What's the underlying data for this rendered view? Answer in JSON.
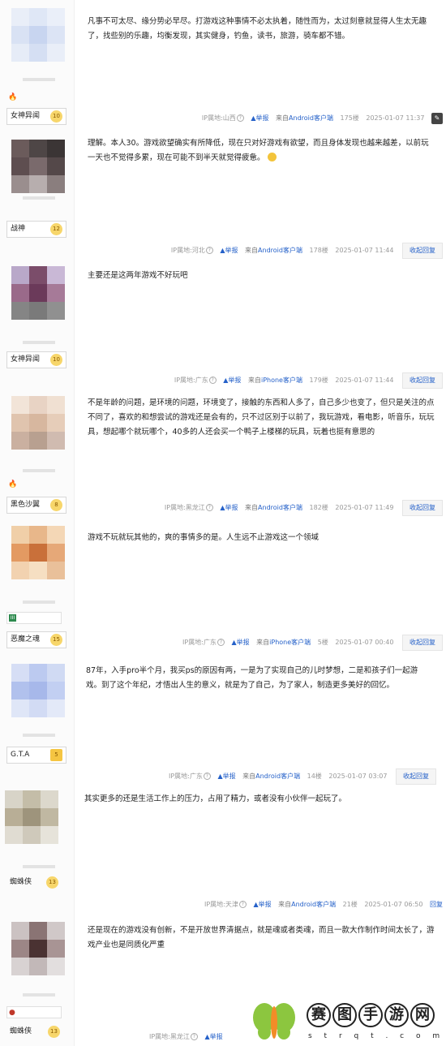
{
  "posts": [
    {
      "user": "女神异闻",
      "level": "10",
      "text": "凡事不可太尽、缘分势必早尽。打游戏这种事情不必太执着，随性而为，太过刻意就显得人生太无趣了，找些别的乐趣，均衡发现，其实健身，钓鱼，读书，旅游，骑车都不错。",
      "ip": "IP属地:山西",
      "report": "举报",
      "client_prefix": "来自",
      "client": "Android客户端",
      "floor": "175楼",
      "time": "2025-01-07 11:37",
      "reply": ""
    },
    {
      "user": "战神",
      "level": "12",
      "text": "理解。本人30。游戏欲望确实有所降低，现在只对好游戏有欲望，而且身体发现也越来越差，以前玩一天也不觉得多累，现在可能不到半天就觉得疲惫。",
      "ip": "IP属地:河北",
      "report": "举报",
      "client_prefix": "来自",
      "client": "Android客户端",
      "floor": "178楼",
      "time": "2025-01-07 11:44",
      "reply": "收起回复"
    },
    {
      "user": "女神异闻",
      "level": "10",
      "text": "主要还是这两年游戏不好玩吧",
      "ip": "IP属地:广东",
      "report": "举报",
      "client_prefix": "来自",
      "client": "iPhone客户端",
      "floor": "179楼",
      "time": "2025-01-07 11:44",
      "reply": "收起回复"
    },
    {
      "user": "黑色沙翼",
      "level": "8",
      "text": "不是年龄的问题，是环境的问题，环境变了，接触的东西和人多了，自己多少也变了，但只是关注的点不同了，喜欢的和想尝试的游戏还是会有的，只不过区别于以前了，我玩游戏，看电影，听音乐，玩玩具，想起哪个就玩哪个，40多的人还会买一个鸭子上楼梯的玩具，玩着也挺有意思的",
      "ip": "IP属地:黑龙江",
      "report": "举报",
      "client_prefix": "来自",
      "client": "Android客户端",
      "floor": "182楼",
      "time": "2025-01-07 11:49",
      "reply": "收起回复"
    },
    {
      "user": "恶魔之魂",
      "level": "15",
      "tag": "III",
      "text": "游戏不玩就玩其他的，爽的事情多的是。人生远不止游戏这一个领域",
      "ip": "IP属地:广东",
      "report": "举报",
      "client_prefix": "来自",
      "client": "iPhone客户端",
      "floor": "5楼",
      "time": "2025-01-07 00:40",
      "reply": "收起回复"
    },
    {
      "user": "G.T.A",
      "level": "5",
      "text": "87年，入手pro半个月，我买ps的原因有两，一是为了实现自己的儿时梦想，二是和孩子们一起游戏。到了这个年纪，才悟出人生的意义，就是为了自己，为了家人，制造更多美好的回忆。",
      "ip": "IP属地:广东",
      "report": "举报",
      "client_prefix": "来自",
      "client": "Android客户端",
      "floor": "14楼",
      "time": "2025-01-07 03:07",
      "reply": "收起回复"
    },
    {
      "user": "蜘蛛侠",
      "level": "13",
      "text": "其实更多的还是生活工作上的压力，占用了精力，或者没有小伙伴一起玩了。",
      "ip": "IP属地:天津",
      "report": "举报",
      "client_prefix": "来自",
      "client": "Android客户端",
      "floor": "21楼",
      "time": "2025-01-07 06:50",
      "reply": "回复"
    },
    {
      "user": "蜘蛛侠",
      "level": "13",
      "text": "还是现在的游戏没有创新，不是开放世界清据点，就是魂或者类魂，而且一款大作制作时间太长了，游戏产业也是同质化严重",
      "ip": "IP属地:黑龙江",
      "report": "举报",
      "client_prefix": "",
      "client": "",
      "floor": "",
      "time": "",
      "reply": ""
    }
  ],
  "watermark": {
    "chars": [
      "赛",
      "图",
      "手",
      "游",
      "网"
    ],
    "sub": "s t r q t . c o m"
  },
  "colors": {
    "link": "#2561c9",
    "meta": "#999999",
    "level": "#f7d66b"
  }
}
